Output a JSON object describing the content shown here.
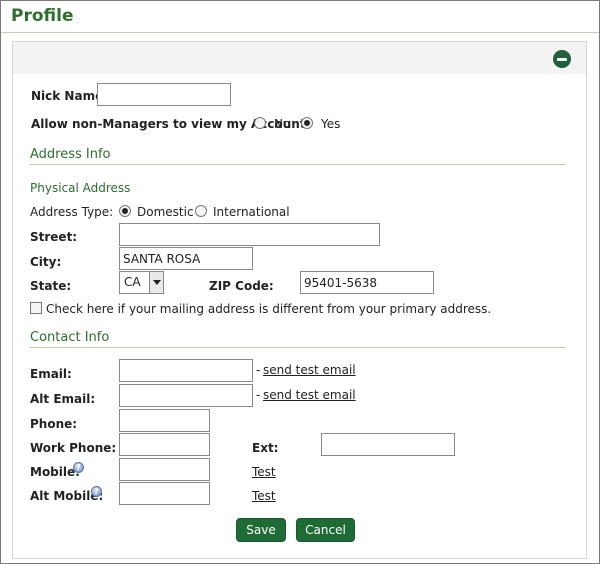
{
  "page": {
    "title": "Profile"
  },
  "account": {
    "nickname_label": "Nick Name:",
    "nickname_value": "",
    "allow_label": "Allow non-Managers to view my Account:",
    "options": [
      "No",
      "Yes"
    ],
    "selected": "Yes"
  },
  "address": {
    "section_title": "Address Info",
    "physical_title": "Physical Address",
    "type_label": "Address Type:",
    "type_options": [
      "Domestic",
      "International"
    ],
    "type_selected": "Domestic",
    "street_label": "Street:",
    "street_value": "",
    "city_label": "City:",
    "city_value": "SANTA ROSA",
    "state_label": "State:",
    "state_value": "CA",
    "zip_label": "ZIP Code:",
    "zip_value": "95401-5638",
    "mailing_check_label": "Check here if your mailing address is different from your primary address.",
    "mailing_checked": false
  },
  "contact": {
    "section_title": "Contact Info",
    "email_label": "Email:",
    "email_value": "",
    "alt_email_label": "Alt Email:",
    "alt_email_value": "",
    "link_prefix": "- ",
    "send_test_email": "send test email",
    "phone_label": "Phone:",
    "phone_value": "",
    "work_phone_label": "Work Phone:",
    "work_phone_value": "",
    "ext_label": "Ext:",
    "ext_value": "",
    "mobile_label": "Mobile:",
    "mobile_value": "",
    "alt_mobile_label": "Alt Mobile:",
    "alt_mobile_value": "",
    "test_link": "Test",
    "help_glyph": "?"
  },
  "actions": {
    "save": "Save",
    "cancel": "Cancel"
  },
  "colors": {
    "brand_green": "#2e6e2e",
    "button_green": "#1f6b36"
  },
  "icons": {
    "collapse": "minus-circle-icon",
    "help": "help-icon"
  }
}
